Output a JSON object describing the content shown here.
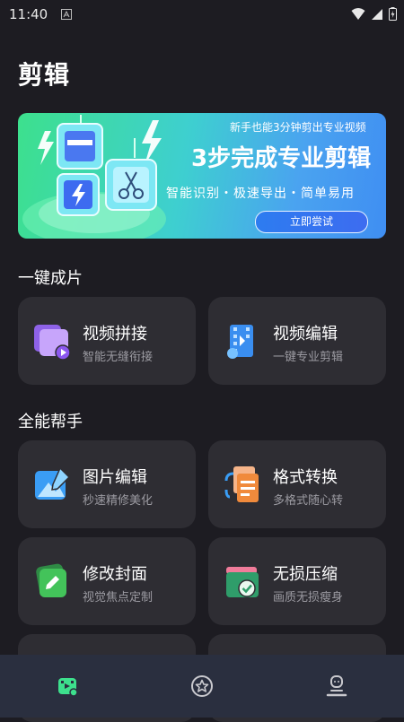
{
  "status": {
    "time": "11:40"
  },
  "header": {
    "title": "剪辑"
  },
  "banner": {
    "top_text": "新手也能3分钟剪出专业视频",
    "main_text": "3步完成专业剪辑",
    "sub_text": "智能识别・极速导出・简单易用",
    "button": "立即尝试"
  },
  "sections": [
    {
      "title": "一键成片",
      "cards": [
        {
          "title": "视频拼接",
          "subtitle": "智能无缝衔接",
          "icon": "video-merge-icon"
        },
        {
          "title": "视频编辑",
          "subtitle": "一键专业剪辑",
          "icon": "film-edit-icon"
        }
      ]
    },
    {
      "title": "全能帮手",
      "cards": [
        {
          "title": "图片编辑",
          "subtitle": "秒速精修美化",
          "icon": "image-edit-icon"
        },
        {
          "title": "格式转换",
          "subtitle": "多格式随心转",
          "icon": "format-convert-icon"
        },
        {
          "title": "修改封面",
          "subtitle": "视觉焦点定制",
          "icon": "cover-edit-icon"
        },
        {
          "title": "无损压缩",
          "subtitle": "画质无损瘦身",
          "icon": "compress-icon"
        }
      ]
    }
  ],
  "bottom_nav": [
    {
      "name": "edit",
      "icon": "film-tab-icon",
      "active": true
    },
    {
      "name": "effects",
      "icon": "star-tab-icon",
      "active": false
    },
    {
      "name": "profile",
      "icon": "profile-tab-icon",
      "active": false
    }
  ],
  "colors": {
    "background": "#1d1c22",
    "card": "#2e2d33",
    "nav": "#2a2f3f",
    "accent": "#3de08d"
  }
}
